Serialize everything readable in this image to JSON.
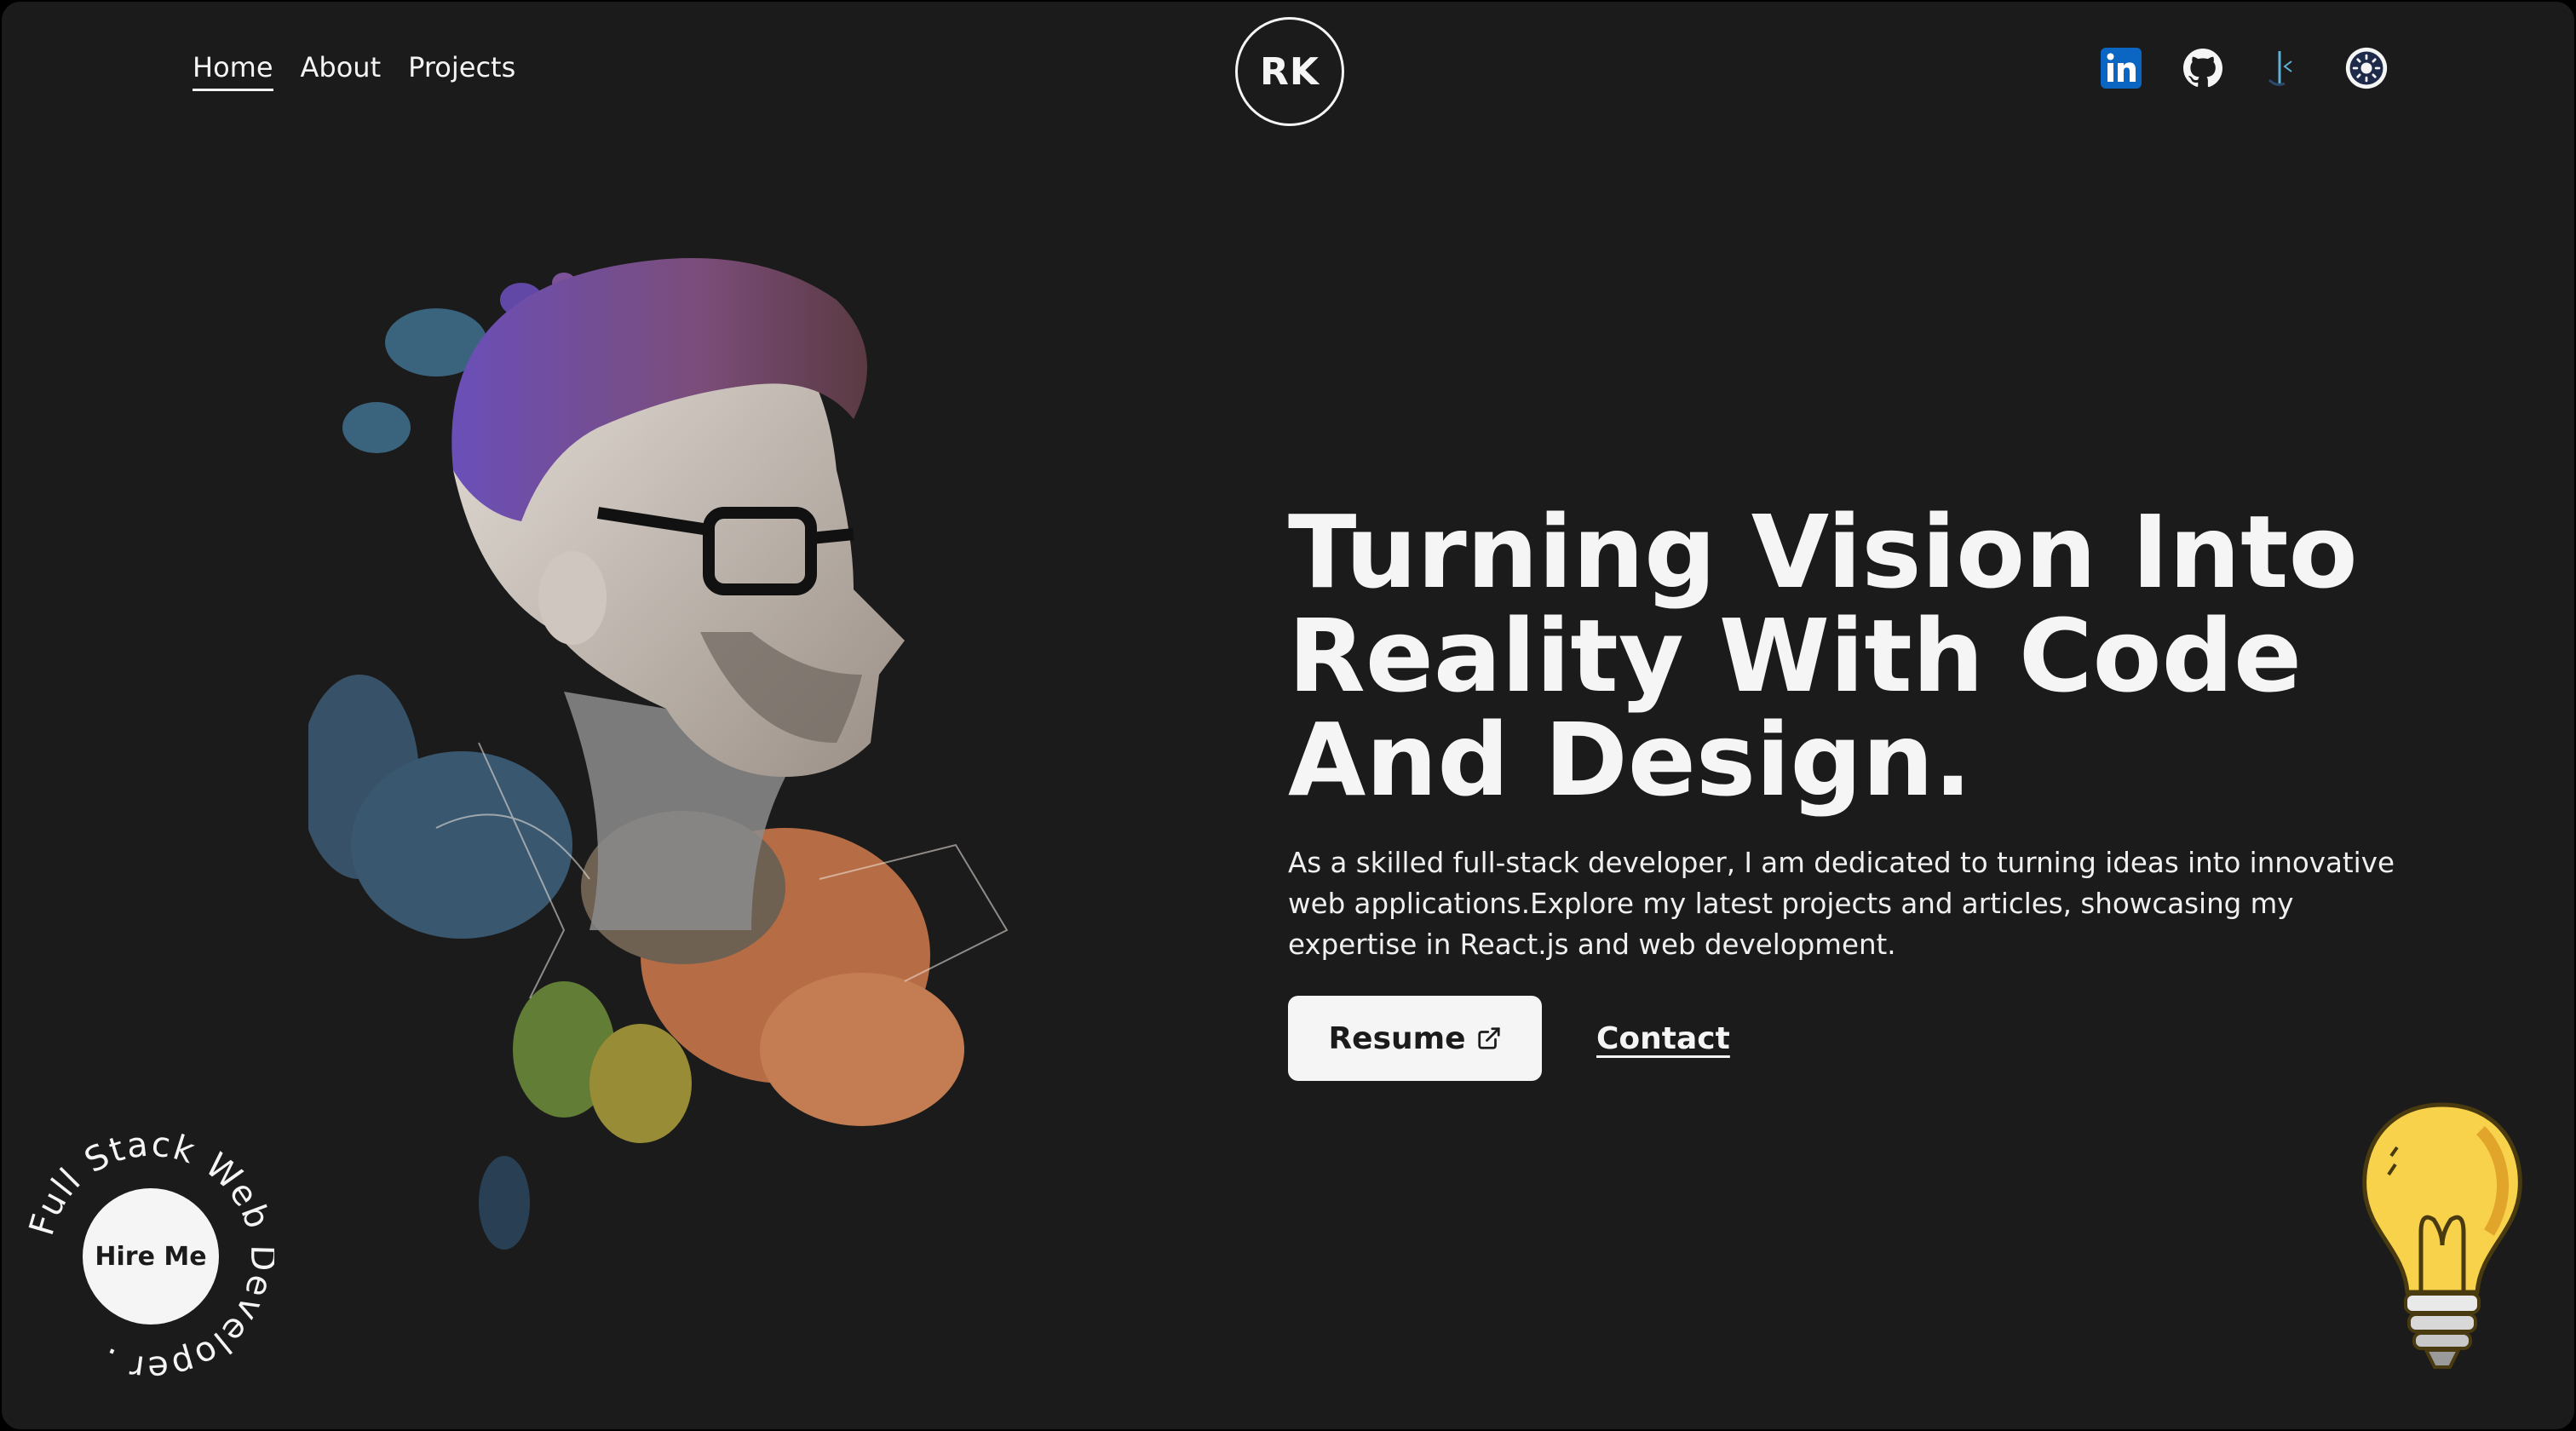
{
  "nav": {
    "links": [
      {
        "label": "Home",
        "active": true
      },
      {
        "label": "About",
        "active": false
      },
      {
        "label": "Projects",
        "active": false
      }
    ],
    "logo": "RK",
    "social_icons": [
      "linkedin-icon",
      "github-icon",
      "dev-platform-icon",
      "gear-toggle-icon"
    ]
  },
  "hero": {
    "headline_lines": [
      "Turning Vision Into",
      "Reality With Code",
      "And Design."
    ],
    "description": "As a skilled full-stack developer, I am dedicated to turning ideas into innovative web applications.Explore my latest projects and articles, showcasing my expertise in React.js and web development.",
    "resume_label": "Resume",
    "contact_label": "Contact"
  },
  "hire": {
    "button_label": "Hire Me",
    "ring_text": "Full Stack Web Developer . "
  },
  "colors": {
    "background": "#1b1b1b",
    "foreground": "#f5f5f5",
    "linkedin": "#0a66c2",
    "bulb": "#f7d24a"
  }
}
